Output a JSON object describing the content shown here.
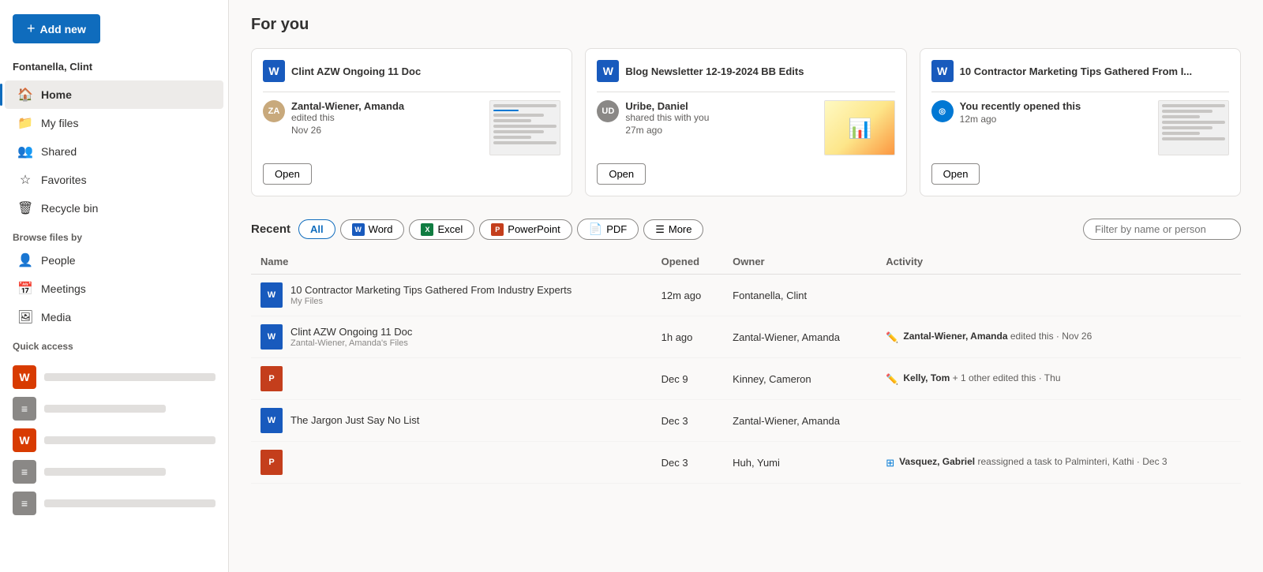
{
  "sidebar": {
    "add_new_label": "Add new",
    "user_name": "Fontanella, Clint",
    "nav_items": [
      {
        "id": "home",
        "label": "Home",
        "icon": "🏠",
        "active": true
      },
      {
        "id": "my-files",
        "label": "My files",
        "icon": "📁",
        "active": false
      },
      {
        "id": "shared",
        "label": "Shared",
        "icon": "👥",
        "active": false
      },
      {
        "id": "favorites",
        "label": "Favorites",
        "icon": "☆",
        "active": false
      },
      {
        "id": "recycle-bin",
        "label": "Recycle bin",
        "icon": "🗑",
        "active": false
      }
    ],
    "browse_label": "Browse files by",
    "browse_items": [
      {
        "id": "people",
        "label": "People",
        "icon": "👤"
      },
      {
        "id": "meetings",
        "label": "Meetings",
        "icon": "📅"
      },
      {
        "id": "media",
        "label": "Media",
        "icon": "🖼"
      }
    ],
    "quick_access_label": "Quick access"
  },
  "main": {
    "page_title": "For you",
    "cards": [
      {
        "id": "card1",
        "title": "Clint AZW Ongoing 11 Doc",
        "person": "Zantal-Wiener, Amanda",
        "action": "edited this",
        "time": "Nov 26",
        "open_label": "Open",
        "avatar_initials": "ZA",
        "avatar_color": "brown"
      },
      {
        "id": "card2",
        "title": "Blog Newsletter 12-19-2024 BB Edits",
        "person": "Uribe, Daniel",
        "action": "shared this with you",
        "time": "27m ago",
        "open_label": "Open",
        "avatar_initials": "UD",
        "avatar_color": "gray"
      },
      {
        "id": "card3",
        "title": "10 Contractor Marketing Tips Gathered From I...",
        "person": "You recently opened this",
        "action": "",
        "time": "12m ago",
        "open_label": "Open",
        "avatar_initials": "◎",
        "avatar_color": "blue"
      }
    ],
    "recent_label": "Recent",
    "filter_tabs": [
      {
        "id": "all",
        "label": "All",
        "active": true
      },
      {
        "id": "word",
        "label": "Word",
        "active": false
      },
      {
        "id": "excel",
        "label": "Excel",
        "active": false
      },
      {
        "id": "powerpoint",
        "label": "PowerPoint",
        "active": false
      },
      {
        "id": "pdf",
        "label": "PDF",
        "active": false
      },
      {
        "id": "more",
        "label": "More",
        "active": false
      }
    ],
    "filter_search_placeholder": "Filter by name or person",
    "table_headers": [
      "Name",
      "Opened",
      "Owner",
      "Activity"
    ],
    "files": [
      {
        "id": "file1",
        "type": "word",
        "name": "10 Contractor Marketing Tips Gathered From Industry Experts",
        "sub": "My Files",
        "opened": "12m ago",
        "owner": "Fontanella, Clint",
        "activity": "",
        "activity_icon": ""
      },
      {
        "id": "file2",
        "type": "word",
        "name": "Clint AZW Ongoing 11 Doc",
        "sub": "Zantal-Wiener, Amanda's Files",
        "opened": "1h ago",
        "owner": "Zantal-Wiener, Amanda",
        "activity": "Zantal-Wiener, Amanda edited this · Nov 26",
        "activity_bold": "Zantal-Wiener, Amanda",
        "activity_rest": " edited this · Nov 26",
        "activity_icon": "pencil"
      },
      {
        "id": "file3",
        "type": "ppt",
        "name": "",
        "sub": "",
        "opened": "Dec 9",
        "owner": "Kinney, Cameron",
        "activity": "Kelly, Tom + 1 other edited this · Thu",
        "activity_bold": "Kelly, Tom",
        "activity_rest": " + 1 other edited this · Thu",
        "activity_icon": "pencil"
      },
      {
        "id": "file4",
        "type": "word",
        "name": "The Jargon Just Say No List",
        "sub": "",
        "opened": "Dec 3",
        "owner": "Zantal-Wiener, Amanda",
        "activity": "",
        "activity_icon": ""
      },
      {
        "id": "file5",
        "type": "ppt",
        "name": "",
        "sub": "",
        "opened": "Dec 3",
        "owner": "Huh, Yumi",
        "activity": "Vasquez, Gabriel reassigned a task to Palminteri, Kathi · Dec 3",
        "activity_bold": "Vasquez, Gabriel",
        "activity_rest": " reassigned a task to Palminteri, Kathi · Dec 3",
        "activity_icon": "list"
      }
    ]
  }
}
